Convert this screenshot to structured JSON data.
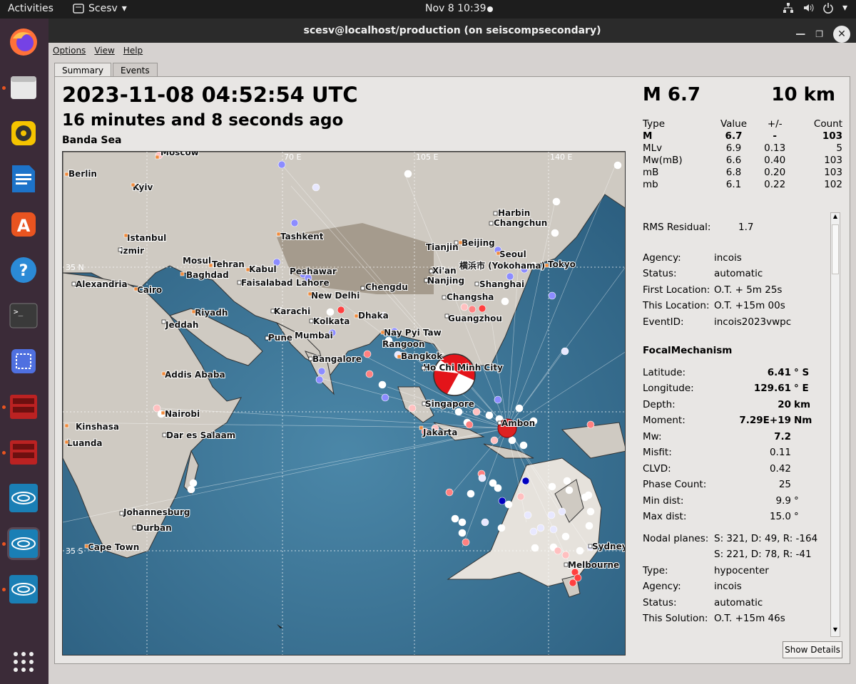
{
  "topbar": {
    "activities": "Activities",
    "app_name": "Scesv",
    "clock": "Nov 8  10:39"
  },
  "window": {
    "title": "scesv@localhost/production (on seiscompsecondary)"
  },
  "menu": [
    "Options",
    "View",
    "Help"
  ],
  "tabs": [
    "Summary",
    "Events"
  ],
  "event": {
    "time": "2023-11-08 04:52:54 UTC",
    "ago": "16 minutes and 8 seconds ago",
    "region": "Banda Sea",
    "magnitude": "M 6.7",
    "depth": "10 km"
  },
  "mag_table": {
    "headers": [
      "Type",
      "Value",
      "+/-",
      "Count"
    ],
    "rows": [
      [
        "M",
        "6.7",
        "-",
        "103"
      ],
      [
        "MLv",
        "6.9",
        "0.13",
        "5"
      ],
      [
        "Mw(mB)",
        "6.6",
        "0.40",
        "103"
      ],
      [
        "mB",
        "6.8",
        "0.20",
        "103"
      ],
      [
        "mb",
        "6.1",
        "0.22",
        "102"
      ]
    ]
  },
  "origin": {
    "rms_label": "RMS Residual:",
    "rms_value": "1.7",
    "agency_label": "Agency:",
    "agency_value": "incois",
    "status_label": "Status:",
    "status_value": "automatic",
    "first_loc_label": "First Location:",
    "first_loc_value": "O.T. + 5m 25s",
    "this_loc_label": "This Location:",
    "this_loc_value": "O.T. +15m 00s",
    "eventid_label": "EventID:",
    "eventid_value": "incois2023vwpc"
  },
  "fm": {
    "title": "FocalMechanism",
    "latitude_label": "Latitude:",
    "latitude": "6.41",
    "latitude_unit": "° S",
    "longitude_label": "Longitude:",
    "longitude": "129.61",
    "longitude_unit": "° E",
    "depth_label": "Depth:",
    "depth": "20",
    "depth_unit": "km",
    "moment_label": "Moment:",
    "moment": "7.29E+19",
    "moment_unit": "Nm",
    "mw_label": "Mw:",
    "mw": "7.2",
    "misfit_label": "Misfit:",
    "misfit": "0.11",
    "clvd_label": "CLVD:",
    "clvd": "0.42",
    "phase_label": "Phase Count:",
    "phase": "25",
    "mindist_label": "Min dist:",
    "mindist": "9.9",
    "mindist_unit": "°",
    "maxdist_label": "Max dist:",
    "maxdist": "15.0",
    "maxdist_unit": "°",
    "nodal_label": "Nodal planes:",
    "nodal1": "S: 321, D: 49, R: -164",
    "nodal2": "S: 221, D: 78, R: -41",
    "type_label": "Type:",
    "type": "hypocenter",
    "agency_label": "Agency:",
    "agency": "incois",
    "status_label": "Status:",
    "status": "automatic",
    "solution_label": "This Solution:",
    "solution": "O.T. +15m 46s"
  },
  "show_details": "Show Details",
  "map": {
    "grid_labels": [
      "70 E",
      "105 E",
      "140 E",
      "35 N",
      "35 S"
    ],
    "cities": [
      "Moscow",
      "Berlin",
      "Kyiv",
      "Istanbul",
      "Izmir",
      "Tashkent",
      "Mosul",
      "Tehran",
      "Baghdad",
      "Kabul",
      "Peshawar",
      "Faisalabad",
      "Lahore",
      "New Delhi",
      "Alexandria",
      "Cairo",
      "Riyadh",
      "Jeddah",
      "Karachi",
      "Pune",
      "Mumbai",
      "Kolkata",
      "Dhaka",
      "Bangalore",
      "Harbin",
      "Changchun",
      "Tianjin",
      "Beijing",
      "Seoul",
      "Tokyo",
      "横浜市 (Yokohama)",
      "Xi'an",
      "Nanjing",
      "Shanghai",
      "Chengdu",
      "Changsha",
      "Guangzhou",
      "Nay Pyi Taw",
      "Rangoon",
      "Bangkok",
      "Ho Chi Minh City",
      "Singapore",
      "Jakarta",
      "Ambon",
      "Addis Ababa",
      "Nairobi",
      "Dar es Salaam",
      "Kinshasa",
      "Luanda",
      "Johannesburg",
      "Durban",
      "Cape Town",
      "Sydney",
      "Melbourne"
    ]
  }
}
